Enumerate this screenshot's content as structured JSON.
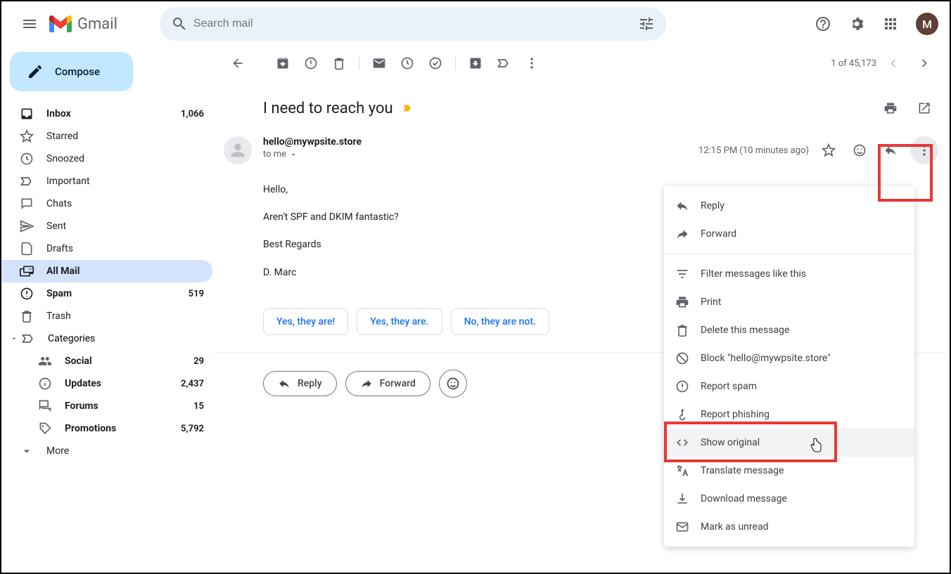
{
  "header": {
    "app_name": "Gmail",
    "search_placeholder": "Search mail",
    "avatar_initial": "M"
  },
  "compose": {
    "label": "Compose"
  },
  "sidebar": {
    "items": [
      {
        "label": "Inbox",
        "count": "1,066",
        "bold": true
      },
      {
        "label": "Starred"
      },
      {
        "label": "Snoozed"
      },
      {
        "label": "Important"
      },
      {
        "label": "Chats"
      },
      {
        "label": "Sent"
      },
      {
        "label": "Drafts"
      },
      {
        "label": "All Mail",
        "active": true
      },
      {
        "label": "Spam",
        "count": "519",
        "bold": true
      },
      {
        "label": "Trash"
      }
    ],
    "categories_label": "Categories",
    "categories": [
      {
        "label": "Social",
        "count": "29",
        "bold": true
      },
      {
        "label": "Updates",
        "count": "2,437",
        "bold": true
      },
      {
        "label": "Forums",
        "count": "15",
        "bold": true
      },
      {
        "label": "Promotions",
        "count": "5,792",
        "bold": true
      }
    ],
    "more_label": "More"
  },
  "toolbar": {
    "position": "1 of 45,173"
  },
  "message": {
    "subject": "I need to reach you",
    "sender": "hello@mywpsite.store",
    "recipient": "to me",
    "timestamp": "12:15 PM (10 minutes ago)",
    "body": [
      "Hello,",
      "Aren't SPF and DKIM fantastic?",
      "Best Regards",
      "D. Marc"
    ],
    "smart_replies": [
      "Yes, they are!",
      "Yes, they are.",
      "No, they are not."
    ],
    "reply_label": "Reply",
    "forward_label": "Forward"
  },
  "dropdown": {
    "items": [
      {
        "label": "Reply",
        "icon": "reply"
      },
      {
        "label": "Forward",
        "icon": "forward"
      }
    ],
    "items2": [
      {
        "label": "Filter messages like this",
        "icon": "filter"
      },
      {
        "label": "Print",
        "icon": "print"
      },
      {
        "label": "Delete this message",
        "icon": "delete"
      },
      {
        "label": "Block \"hello@mywpsite.store\"",
        "icon": "block"
      },
      {
        "label": "Report spam",
        "icon": "spam"
      },
      {
        "label": "Report phishing",
        "icon": "phishing"
      },
      {
        "label": "Show original",
        "icon": "code",
        "hovered": true
      },
      {
        "label": "Translate message",
        "icon": "translate"
      },
      {
        "label": "Download message",
        "icon": "download"
      },
      {
        "label": "Mark as unread",
        "icon": "unread"
      }
    ]
  }
}
